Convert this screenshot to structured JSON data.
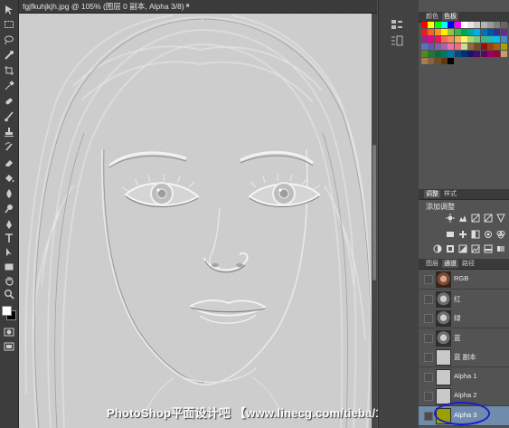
{
  "document": {
    "tab_title": "fgjfkuhjkjh.jpg @ 105% (图层 0 副本, Alpha 3/8) *",
    "close_symbol": "×"
  },
  "watermark": "PhotoShop平面设计吧 【www.linecg.com/tieba/1783】",
  "swatches_panel": {
    "tabs": [
      "颜色",
      "色板"
    ],
    "active_tab": "色板",
    "colors": [
      "#ff0000",
      "#ffff00",
      "#00ff00",
      "#00ffff",
      "#0000ff",
      "#ff00ff",
      "#ffffff",
      "#e6e6e6",
      "#cccccc",
      "#b3b3b3",
      "#999999",
      "#808080",
      "#666666",
      "#ed1c24",
      "#f26522",
      "#f7941d",
      "#fff200",
      "#8dc63f",
      "#39b54a",
      "#00a651",
      "#00a99d",
      "#00aeef",
      "#0072bc",
      "#0054a6",
      "#2e3192",
      "#662d91",
      "#92278f",
      "#ec008c",
      "#ed145b",
      "#f26c4f",
      "#f68e56",
      "#fbaf5d",
      "#fff568",
      "#acd373",
      "#7cc576",
      "#3cb878",
      "#1cbbb4",
      "#00bff3",
      "#448ccb",
      "#5674b9",
      "#605ca8",
      "#855fa8",
      "#a864a8",
      "#f06eaa",
      "#f26d7d",
      "#c4df9b",
      "#8a6d3b",
      "#754c24",
      "#9e0b0f",
      "#a0410d",
      "#a36209",
      "#aba000",
      "#598527",
      "#1a7b30",
      "#007236",
      "#00746b",
      "#0076a3",
      "#004a80",
      "#003471",
      "#1b1464",
      "#440e62",
      "#630460",
      "#9e005d",
      "#9e0039",
      "#c69c6d",
      "#a67c52",
      "#8c6239",
      "#754c24",
      "#603913",
      "#000000"
    ]
  },
  "adjustments_panel": {
    "tabs": [
      "调整",
      "样式"
    ],
    "active_tab": "调整",
    "title": "添加调整",
    "icons": [
      "brightness-icon",
      "levels-icon",
      "curves-icon",
      "exposure-icon",
      "vibrance-icon",
      "hue-saturation-icon",
      "color-balance-icon",
      "black-white-icon",
      "photo-filter-icon",
      "channel-mixer-icon",
      "color-lookup-icon",
      "invert-icon",
      "posterize-icon",
      "threshold-icon",
      "gradient-map-icon",
      "selective-color-icon"
    ]
  },
  "channels_panel": {
    "tabs": [
      "图层",
      "通道",
      "路径"
    ],
    "active_tab": "通道",
    "rows": [
      {
        "label": "RGB",
        "thumb": "color"
      },
      {
        "label": "红",
        "thumb": "gray"
      },
      {
        "label": "绿",
        "thumb": "gray"
      },
      {
        "label": "蓝",
        "thumb": "gray"
      },
      {
        "label": "蓝 副本",
        "thumb": "light"
      },
      {
        "label": "Alpha 1",
        "thumb": "light"
      },
      {
        "label": "Alpha 2",
        "thumb": "light"
      },
      {
        "label": "Alpha 3",
        "thumb": "yellow",
        "selected": true
      }
    ]
  },
  "colors": {
    "selected_row": "#6f8cad",
    "highlight_ring": "#1d1dc9",
    "alpha3_thumb": "#9aa000"
  }
}
